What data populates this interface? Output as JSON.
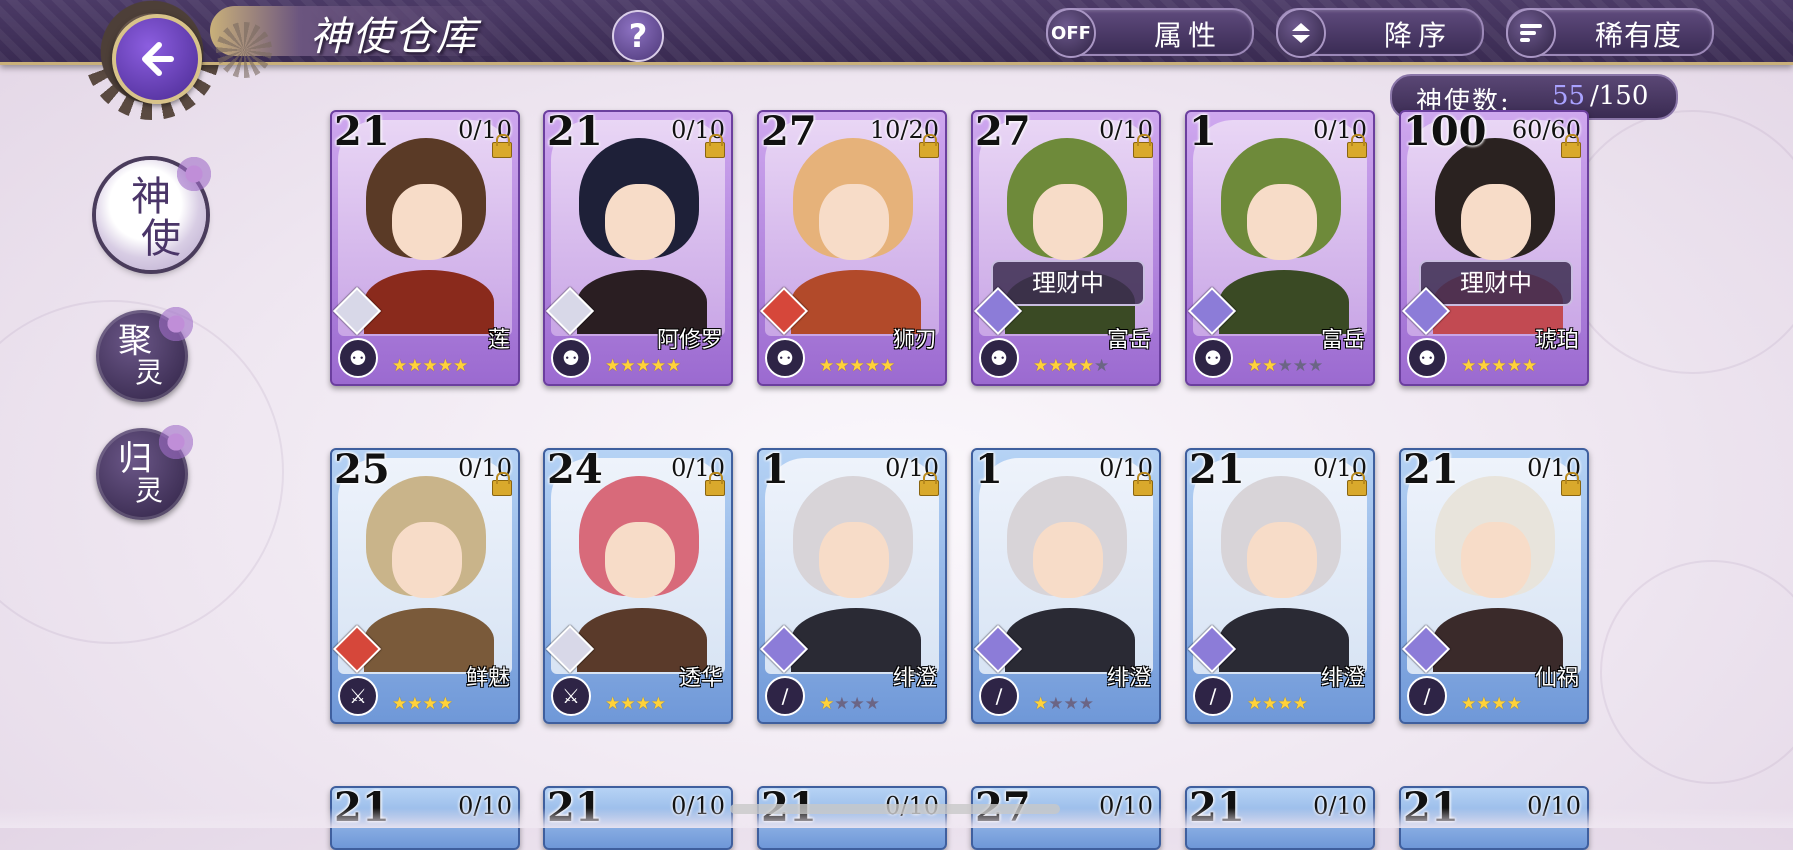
{
  "header": {
    "title": "神使仓库",
    "help_label": "?",
    "filter": {
      "icon_text": "OFF",
      "label": "属性"
    },
    "order": {
      "label": "降序"
    },
    "sort": {
      "label": "稀有度"
    }
  },
  "count": {
    "label": "神使数:",
    "current": "55",
    "max": "/150"
  },
  "side_menu": [
    {
      "top": "神",
      "bottom": "使",
      "active": true
    },
    {
      "top": "聚",
      "bottom": "灵",
      "active": false
    },
    {
      "top": "归",
      "bottom": "灵",
      "active": false
    }
  ],
  "colors": {
    "rarity_purple": "#9b6ad0",
    "rarity_blue": "#6f98d8",
    "star_on": "#ffd23a",
    "accent_gold": "#c9b07a"
  },
  "cards": [
    {
      "level": "21",
      "exp": "0/10",
      "name": "莲",
      "stars": 5,
      "max_stars": 5,
      "rarity": "purple",
      "element_color": "#d8d8e8",
      "class_icon": "helmet-icon",
      "status": "",
      "hair": "#5a3a26",
      "outfit": "#8a2a1c"
    },
    {
      "level": "21",
      "exp": "0/10",
      "name": "阿修罗",
      "stars": 5,
      "max_stars": 5,
      "rarity": "purple",
      "element_color": "#d8d8e8",
      "class_icon": "helmet-icon",
      "status": "",
      "hair": "#1e2038",
      "outfit": "#2a1e22"
    },
    {
      "level": "27",
      "exp": "10/20",
      "name": "狮刃",
      "stars": 5,
      "max_stars": 5,
      "rarity": "purple",
      "element_color": "#d6473a",
      "class_icon": "helmet-icon",
      "status": "",
      "hair": "#e6b27a",
      "outfit": "#b24a2a"
    },
    {
      "level": "27",
      "exp": "0/10",
      "name": "富岳",
      "stars": 4,
      "max_stars": 5,
      "rarity": "purple",
      "element_color": "#8c7cd8",
      "class_icon": "helmet-icon",
      "status": "理财中",
      "hair": "#6e8a3a",
      "outfit": "#3a4a24"
    },
    {
      "level": "1",
      "exp": "0/10",
      "name": "富岳",
      "stars": 2,
      "max_stars": 5,
      "rarity": "purple",
      "element_color": "#8c7cd8",
      "class_icon": "helmet-icon",
      "status": "",
      "hair": "#6e8a3a",
      "outfit": "#3a4a24"
    },
    {
      "level": "100",
      "exp": "60/60",
      "name": "琥珀",
      "stars": 5,
      "max_stars": 5,
      "rarity": "purple",
      "element_color": "#8c7cd8",
      "class_icon": "helmet-icon",
      "status": "理财中",
      "hair": "#2a2220",
      "outfit": "#c24a52"
    },
    {
      "level": "25",
      "exp": "0/10",
      "name": "鲜魅",
      "stars": 4,
      "max_stars": 4,
      "rarity": "blue",
      "element_color": "#d6473a",
      "class_icon": "claw-icon",
      "status": "",
      "hair": "#c9b48a",
      "outfit": "#7a5a3a"
    },
    {
      "level": "24",
      "exp": "0/10",
      "name": "透华",
      "stars": 4,
      "max_stars": 4,
      "rarity": "blue",
      "element_color": "#d8d8e8",
      "class_icon": "claw-icon",
      "status": "",
      "hair": "#d86a7a",
      "outfit": "#5a3a2a"
    },
    {
      "level": "1",
      "exp": "0/10",
      "name": "绯澄",
      "stars": 1,
      "max_stars": 4,
      "rarity": "blue",
      "element_color": "#8c7cd8",
      "class_icon": "blade-icon",
      "status": "",
      "hair": "#d8d4d8",
      "outfit": "#2a2a34"
    },
    {
      "level": "1",
      "exp": "0/10",
      "name": "绯澄",
      "stars": 1,
      "max_stars": 4,
      "rarity": "blue",
      "element_color": "#8c7cd8",
      "class_icon": "blade-icon",
      "status": "",
      "hair": "#d8d4d8",
      "outfit": "#2a2a34"
    },
    {
      "level": "21",
      "exp": "0/10",
      "name": "绯澄",
      "stars": 4,
      "max_stars": 4,
      "rarity": "blue",
      "element_color": "#8c7cd8",
      "class_icon": "blade-icon",
      "status": "",
      "hair": "#d8d4d8",
      "outfit": "#2a2a34"
    },
    {
      "level": "21",
      "exp": "0/10",
      "name": "仙祸",
      "stars": 4,
      "max_stars": 4,
      "rarity": "blue",
      "element_color": "#8c7cd8",
      "class_icon": "blade-icon",
      "status": "",
      "hair": "#e8e4dc",
      "outfit": "#3a2a2a"
    }
  ],
  "partial_cards": [
    {
      "level": "21",
      "exp": "0/10"
    },
    {
      "level": "21",
      "exp": "0/10"
    },
    {
      "level": "21",
      "exp": "0/10"
    },
    {
      "level": "27",
      "exp": "0/10"
    },
    {
      "level": "21",
      "exp": "0/10"
    },
    {
      "level": "21",
      "exp": "0/10"
    }
  ]
}
